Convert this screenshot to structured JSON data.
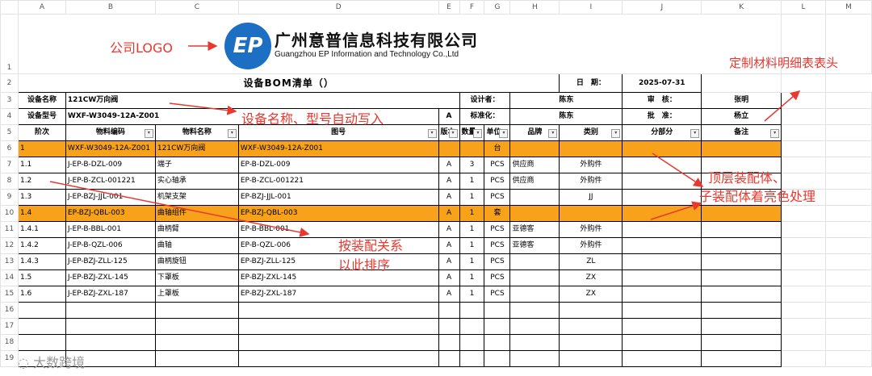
{
  "columns": [
    "A",
    "B",
    "C",
    "D",
    "E",
    "F",
    "G",
    "H",
    "I",
    "J",
    "K",
    "L",
    "M"
  ],
  "row_numbers": [
    "1",
    "2",
    "3",
    "4",
    "5",
    "6",
    "7",
    "8",
    "9",
    "10",
    "11",
    "12",
    "13",
    "14",
    "15",
    "16",
    "17",
    "18",
    "19"
  ],
  "logo": {
    "mark": "EP",
    "company_cn": "广州意普信息科技有限公司",
    "company_en": "Guangzhou EP Information and Technology Co.,Ltd"
  },
  "header": {
    "title": "设备BOM清单（）",
    "date_label": "日　期：",
    "date_value": "2025-07-31",
    "device_name_label": "设备名称",
    "device_name_value": "121CW万向阀",
    "designer_label": "设计者：",
    "designer_value": "陈东",
    "reviewer_label": "审　核：",
    "reviewer_value": "张明",
    "device_model_label": "设备型号",
    "device_model_value": "WXF-W3049-12A-Z001",
    "rev_value": "A",
    "standard_label": "标准化：",
    "standard_value": "陈东",
    "approve_label": "批　准：",
    "approve_value": "杨立"
  },
  "table": {
    "headers": [
      "阶次",
      "物料编码",
      "物料名称",
      "图号",
      "版本",
      "数量",
      "单位",
      "品牌",
      "类别",
      "分部分",
      "备注"
    ],
    "rows": [
      {
        "level": "1",
        "code": "WXF-W3049-12A-Z001",
        "name": "121CW万向阀",
        "drawing": "WXF-W3049-12A-Z001",
        "rev": "",
        "qty": "",
        "unit": "台",
        "brand": "",
        "category": "",
        "part": "",
        "note": "",
        "highlight": true
      },
      {
        "level": "1.1",
        "code": "J-EP-B-DZL-009",
        "name": "端子",
        "drawing": "EP-B-DZL-009",
        "rev": "A",
        "qty": "3",
        "unit": "PCS",
        "brand": "供应商",
        "category": "外购件",
        "part": "",
        "note": "",
        "highlight": false
      },
      {
        "level": "1.2",
        "code": "J-EP-B-ZCL-001221",
        "name": "实心轴承",
        "drawing": "EP-B-ZCL-001221",
        "rev": "A",
        "qty": "1",
        "unit": "PCS",
        "brand": "供应商",
        "category": "外购件",
        "part": "",
        "note": "",
        "highlight": false
      },
      {
        "level": "1.3",
        "code": "J-EP-BZJ-JJL-001",
        "name": "机架支架",
        "drawing": "EP-BZJ-JJL-001",
        "rev": "A",
        "qty": "1",
        "unit": "PCS",
        "brand": "",
        "category": "JJ",
        "part": "",
        "note": "",
        "highlight": false
      },
      {
        "level": "1.4",
        "code": "EP-BZJ-QBL-003",
        "name": "曲轴组件",
        "drawing": "EP-BZJ-QBL-003",
        "rev": "A",
        "qty": "1",
        "unit": "套",
        "brand": "",
        "category": "",
        "part": "",
        "note": "",
        "highlight": true
      },
      {
        "level": "1.4.1",
        "code": "J-EP-B-BBL-001",
        "name": "曲柄臂",
        "drawing": "EP-B-BBL-001",
        "rev": "A",
        "qty": "1",
        "unit": "PCS",
        "brand": "亚德客",
        "category": "外购件",
        "part": "",
        "note": "",
        "highlight": false
      },
      {
        "level": "1.4.2",
        "code": "J-EP-B-QZL-006",
        "name": "曲轴",
        "drawing": "EP-B-QZL-006",
        "rev": "A",
        "qty": "1",
        "unit": "PCS",
        "brand": "亚德客",
        "category": "外购件",
        "part": "",
        "note": "",
        "highlight": false
      },
      {
        "level": "1.4.3",
        "code": "J-EP-BZJ-ZLL-125",
        "name": "曲柄旋钮",
        "drawing": "EP-BZJ-ZLL-125",
        "rev": "A",
        "qty": "1",
        "unit": "PCS",
        "brand": "",
        "category": "ZL",
        "part": "",
        "note": "",
        "highlight": false
      },
      {
        "level": "1.5",
        "code": "J-EP-BZJ-ZXL-145",
        "name": "下罩板",
        "drawing": "EP-BZJ-ZXL-145",
        "rev": "A",
        "qty": "1",
        "unit": "PCS",
        "brand": "",
        "category": "ZX",
        "part": "",
        "note": "",
        "highlight": false
      },
      {
        "level": "1.6",
        "code": "J-EP-BZJ-ZXL-187",
        "name": "上罩板",
        "drawing": "EP-BZJ-ZXL-187",
        "rev": "A",
        "qty": "1",
        "unit": "PCS",
        "brand": "",
        "category": "ZX",
        "part": "",
        "note": "",
        "highlight": false
      }
    ]
  },
  "annotations": {
    "logo": "公司LOGO",
    "auto_fill": "设备名称、型号自动写入",
    "header_custom": "定制材料明细表表头",
    "highlight_1": "顶层装配体、",
    "highlight_2": "子装配体着亮色处理",
    "sort_1": "按装配关系",
    "sort_2": "以此排序"
  },
  "watermark": "大数跨境",
  "colors": {
    "highlight": "#f7a21a",
    "annotation": "#e8382f",
    "logo_blue": "#1d6fc4"
  }
}
